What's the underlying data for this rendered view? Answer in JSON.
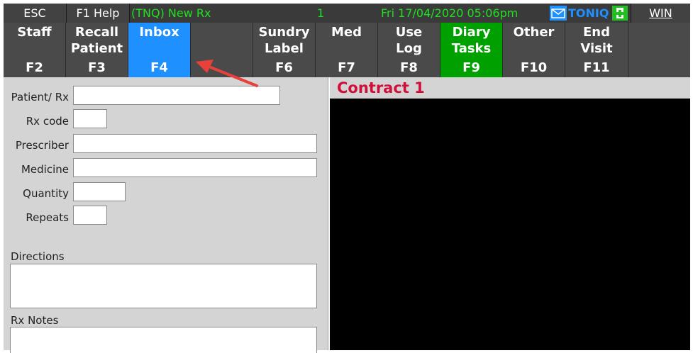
{
  "topbar": {
    "esc_label": "ESC",
    "help_label": "F1 Help",
    "title": "(TNQ) New Rx",
    "count": "1",
    "datetime": "Fri 17/04/2020 05:06pm",
    "user": "TONIQ",
    "win_label": "WIN"
  },
  "fkeys": [
    {
      "label": "Staff",
      "key": "F2"
    },
    {
      "label": "Recall\nPatient",
      "key": "F3"
    },
    {
      "label": "Inbox",
      "key": "F4"
    },
    {
      "label": "",
      "key": ""
    },
    {
      "label": "Sundry\nLabel",
      "key": "F6"
    },
    {
      "label": "Med",
      "key": "F7"
    },
    {
      "label": "Use\nLog",
      "key": "F8"
    },
    {
      "label": "Diary\nTasks",
      "key": "F9"
    },
    {
      "label": "Other",
      "key": "F10"
    },
    {
      "label": "End\nVisit",
      "key": "F11"
    },
    {
      "label": "",
      "key": ""
    }
  ],
  "form": {
    "patient_rx_label": "Patient/ Rx",
    "rx_code_label": "Rx code",
    "prescriber_label": "Prescriber",
    "medicine_label": "Medicine",
    "quantity_label": "Quantity",
    "repeats_label": "Repeats",
    "directions_label": "Directions",
    "rx_notes_label": "Rx Notes",
    "patient_rx_value": "",
    "rx_code_value": "",
    "prescriber_value": "",
    "medicine_value": "",
    "quantity_value": "",
    "repeats_value": ""
  },
  "contract": {
    "title": "Contract 1"
  },
  "colors": {
    "active_tab": "#1e90ff",
    "diary_tab": "#00a000",
    "status_text": "#20e020",
    "contract_title": "#d0103a",
    "arrow": "#e8403a"
  }
}
